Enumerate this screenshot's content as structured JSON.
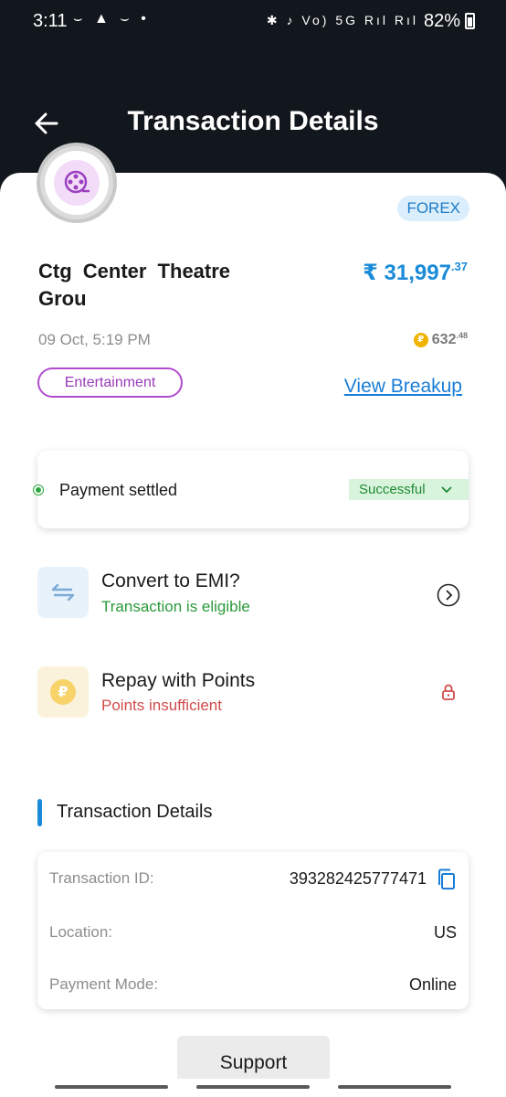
{
  "status_bar": {
    "time": "3:11",
    "left_icons": "⌣ ▲ ⌣ •",
    "right_icons": "✱ ♪ Vo) 5G Rıl Rıl",
    "battery_percent": "82%"
  },
  "header": {
    "title": "Transaction Details"
  },
  "transaction": {
    "badge": "FOREX",
    "merchant_name": "Ctg Center Theatre Grou",
    "amount_currency": "₹",
    "amount_main": "31,997",
    "amount_decimal": ".37",
    "date": "09 Oct, 5:19 PM",
    "points_coin": "₽",
    "points_main": "632",
    "points_decimal": ".48",
    "category": "Entertainment",
    "view_breakup": "View Breakup"
  },
  "status_card": {
    "label": "Payment settled",
    "status": "Successful",
    "status_color": "#1f8a34"
  },
  "options": {
    "emi": {
      "title": "Convert to EMI?",
      "subtitle": "Transaction is eligible",
      "subtitle_color": "#2a9a3a"
    },
    "points": {
      "title": "Repay with Points",
      "subtitle": "Points insufficient",
      "subtitle_color": "#d04a4a",
      "coin": "₽"
    }
  },
  "details": {
    "section_title": "Transaction Details",
    "rows": [
      {
        "label": "Transaction ID:",
        "value": "393282425777471"
      },
      {
        "label": "Location:",
        "value": "US"
      },
      {
        "label": "Payment Mode:",
        "value": "Online"
      }
    ]
  },
  "support": {
    "label": "Support"
  },
  "colors": {
    "header_bg": "#12171d",
    "accent_blue": "#1a8bd9",
    "category_purple": "#b04ccf"
  }
}
